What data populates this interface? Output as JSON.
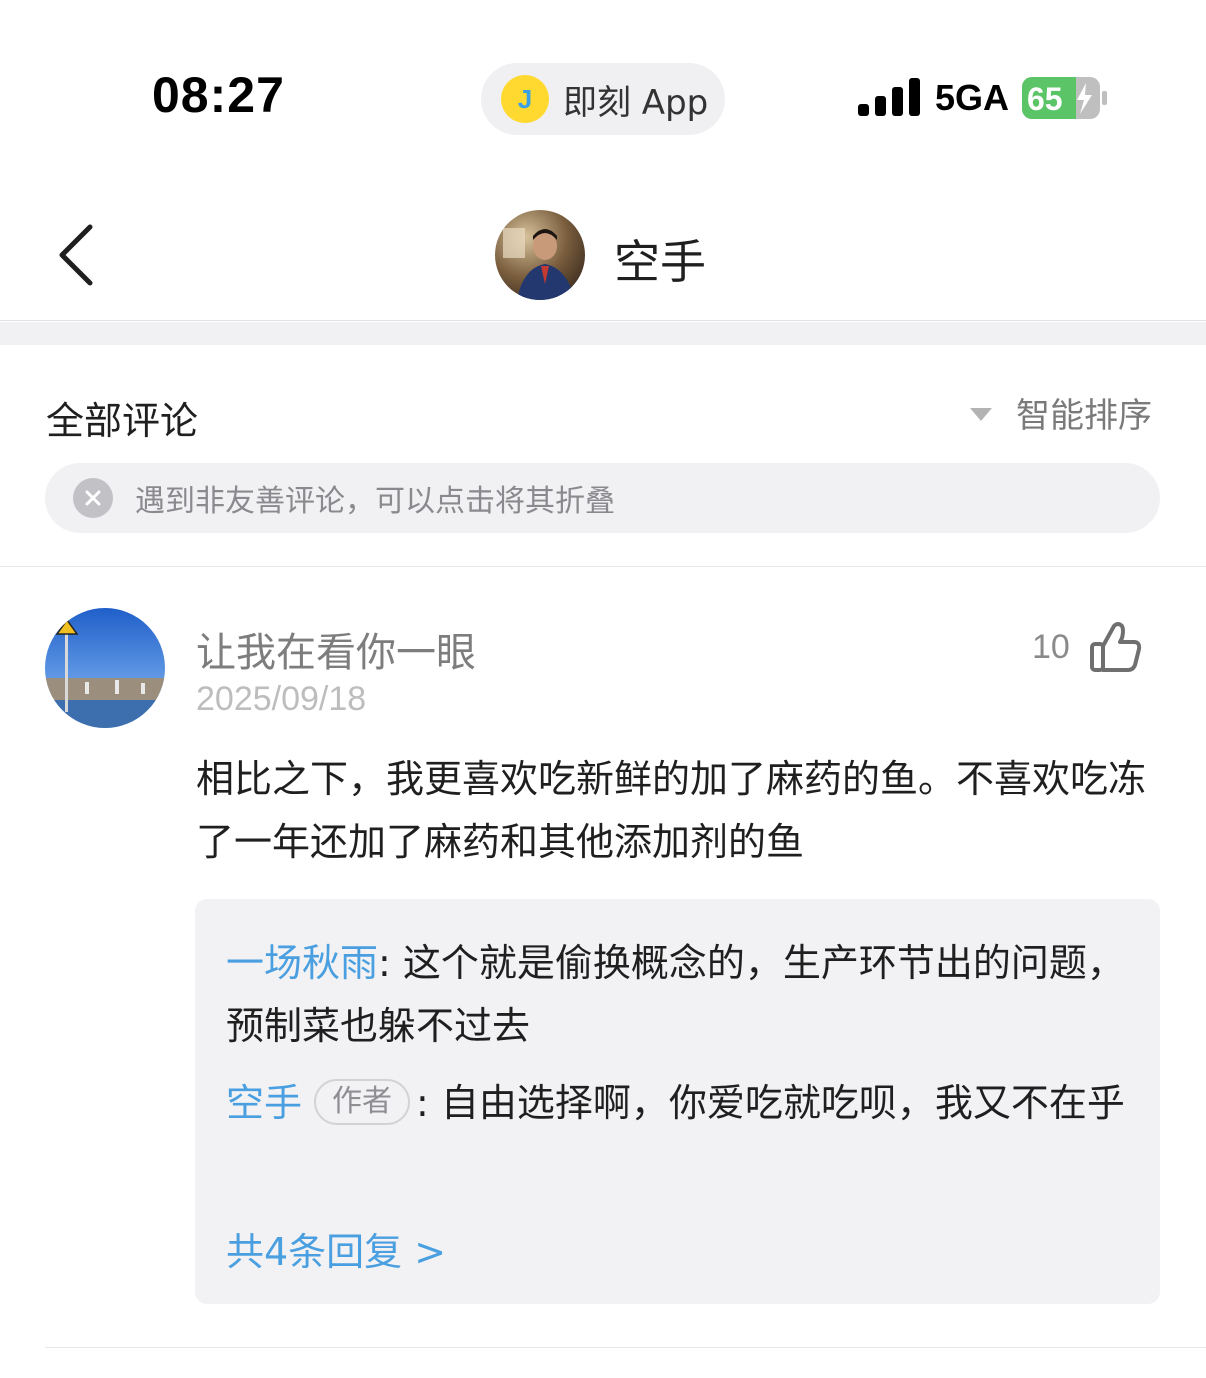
{
  "status_bar": {
    "time": "08:27",
    "app_pill_logo": "J",
    "app_pill_label": "即刻 App",
    "network": "5GA",
    "battery_level": "65",
    "icons": [
      "signal-icon",
      "battery-charging-icon"
    ]
  },
  "header": {
    "title": "空手",
    "back_icon": "chevron-left-icon"
  },
  "comments_section": {
    "title": "全部评论",
    "sort_label": "智能排序",
    "notice_text": "遇到非友善评论，可以点击将其折叠"
  },
  "comment": {
    "author": "让我在看你一眼",
    "date": "2025/09/18",
    "like_count": "10",
    "body": "相比之下，我更喜欢吃新鲜的加了麻药的鱼。不喜欢吃冻了一年还加了麻药和其他添加剂的鱼",
    "replies": [
      {
        "user": "一场秋雨",
        "separator": ": ",
        "text": "这个就是偷换概念的，生产环节出的问题，预制菜也躲不过去"
      },
      {
        "user": "空手",
        "tag": "作者",
        "separator": ": ",
        "text": "自由选择啊，你爱吃就吃呗，我又不在乎"
      }
    ],
    "more_replies_label": "共4条回复 >"
  },
  "colors": {
    "link_blue": "#4a9fe0",
    "logo_yellow": "#ffd930",
    "battery_green": "#5bc466",
    "reply_bg": "#f2f2f4"
  }
}
